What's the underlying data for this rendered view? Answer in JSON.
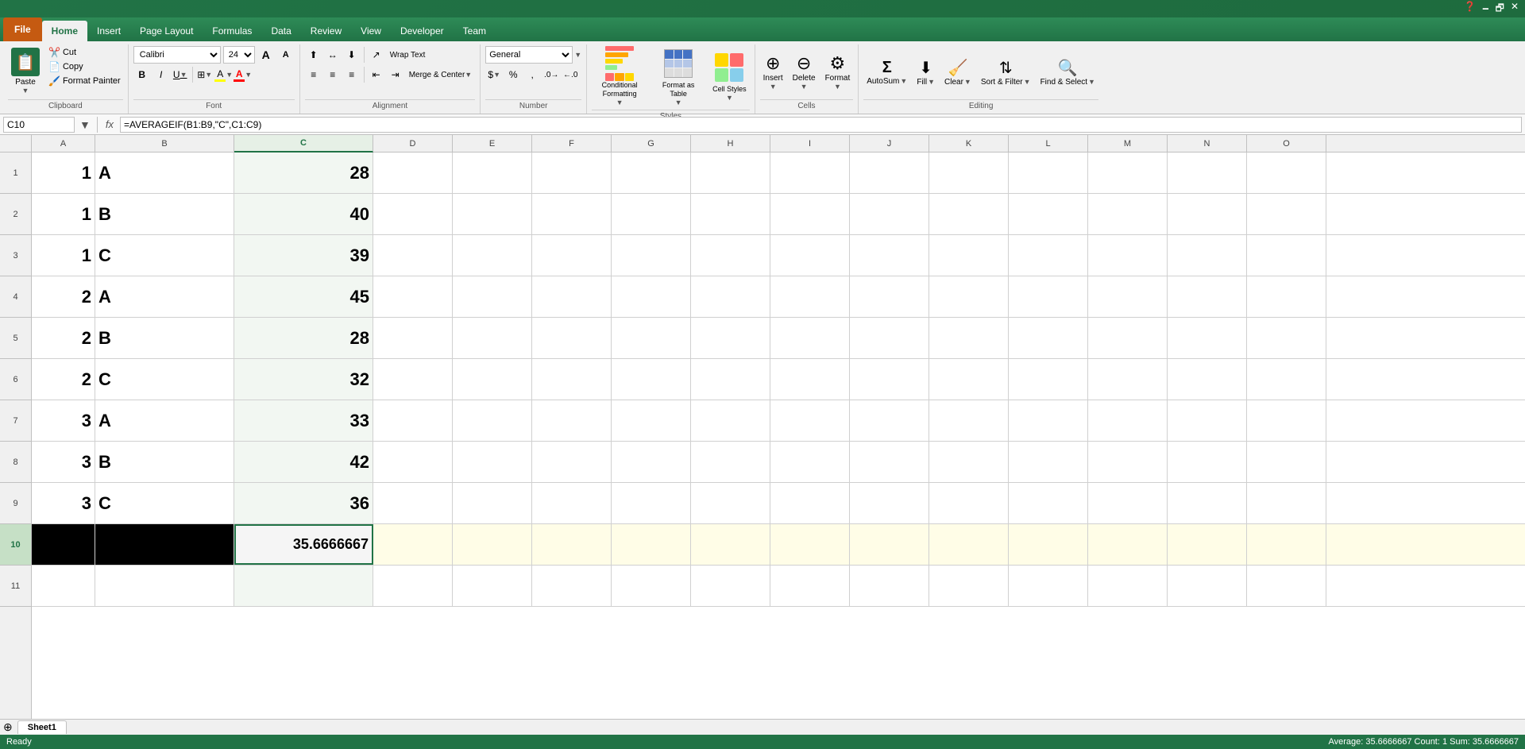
{
  "titleBar": {
    "icons": [
      "minimize",
      "restore",
      "close"
    ]
  },
  "ribbonTabs": {
    "tabs": [
      {
        "id": "file",
        "label": "File",
        "active": true,
        "isFile": true
      },
      {
        "id": "home",
        "label": "Home",
        "active": true
      },
      {
        "id": "insert",
        "label": "Insert",
        "active": false
      },
      {
        "id": "pageLayout",
        "label": "Page Layout",
        "active": false
      },
      {
        "id": "formulas",
        "label": "Formulas",
        "active": false
      },
      {
        "id": "data",
        "label": "Data",
        "active": false
      },
      {
        "id": "review",
        "label": "Review",
        "active": false
      },
      {
        "id": "view",
        "label": "View",
        "active": false
      },
      {
        "id": "developer",
        "label": "Developer",
        "active": false
      },
      {
        "id": "team",
        "label": "Team",
        "active": false
      }
    ]
  },
  "clipboard": {
    "paste_label": "Paste",
    "cut_label": "Cut",
    "copy_label": "Copy",
    "format_painter_label": "Format Painter",
    "group_label": "Clipboard"
  },
  "font": {
    "font_name": "Calibri",
    "font_size": "24",
    "bold_label": "B",
    "italic_label": "I",
    "underline_label": "U",
    "group_label": "Font"
  },
  "alignment": {
    "wrap_text_label": "Wrap Text",
    "merge_center_label": "Merge & Center",
    "group_label": "Alignment"
  },
  "number": {
    "format_label": "General",
    "group_label": "Number"
  },
  "styles": {
    "conditional_label": "Conditional Formatting",
    "format_table_label": "Format as Table",
    "cell_styles_label": "Cell Styles",
    "group_label": "Styles"
  },
  "cells": {
    "insert_label": "Insert",
    "delete_label": "Delete",
    "format_label": "Format",
    "group_label": "Cells"
  },
  "editing": {
    "autosum_label": "AutoSum",
    "fill_label": "Fill",
    "clear_label": "Clear",
    "sort_filter_label": "Sort & Filter",
    "find_select_label": "Find & Select",
    "group_label": "Editing"
  },
  "formulaBar": {
    "cell_ref": "C10",
    "formula": "=AVERAGEIF(B1:B9,\"C\",C1:C9)"
  },
  "grid": {
    "columns": [
      "A",
      "B",
      "C",
      "D",
      "E",
      "F",
      "G",
      "H",
      "I",
      "J",
      "K",
      "L",
      "M",
      "N",
      "O"
    ],
    "activeColumn": "C",
    "activeRow": 10,
    "rows": [
      {
        "row": 1,
        "a": "1",
        "b": "A",
        "c": "28"
      },
      {
        "row": 2,
        "a": "1",
        "b": "B",
        "c": "40"
      },
      {
        "row": 3,
        "a": "1",
        "b": "C",
        "c": "39"
      },
      {
        "row": 4,
        "a": "2",
        "b": "A",
        "c": "45"
      },
      {
        "row": 5,
        "a": "2",
        "b": "B",
        "c": "28"
      },
      {
        "row": 6,
        "a": "2",
        "b": "C",
        "c": "32"
      },
      {
        "row": 7,
        "a": "3",
        "b": "A",
        "c": "33"
      },
      {
        "row": 8,
        "a": "3",
        "b": "B",
        "c": "42"
      },
      {
        "row": 9,
        "a": "3",
        "b": "C",
        "c": "36"
      },
      {
        "row": 10,
        "a": "",
        "b": "",
        "c": "35.6666667"
      }
    ]
  },
  "sheetTabs": {
    "sheets": [
      {
        "label": "Sheet1",
        "active": true
      }
    ],
    "new_sheet_label": "+"
  },
  "statusBar": {
    "left": "Ready",
    "right": "Average: 35.6666667   Count: 1   Sum: 35.6666667"
  }
}
